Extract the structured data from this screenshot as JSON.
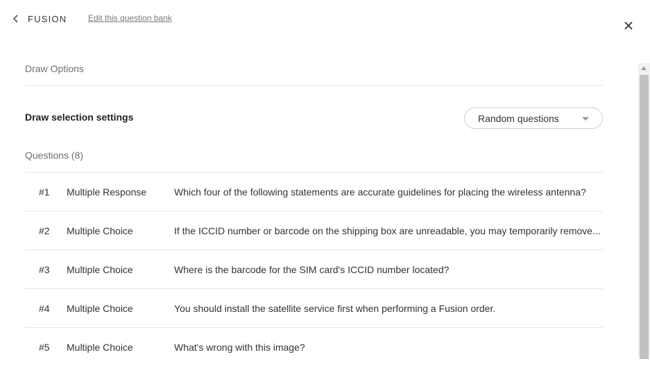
{
  "header": {
    "back_label": "FUSION",
    "edit_link": "Edit this question bank"
  },
  "draw_options": {
    "title": "Draw Options",
    "settings_label": "Draw selection settings",
    "selection": "Random questions"
  },
  "questions": {
    "title": "Questions (8)",
    "rows": [
      {
        "num": "#1",
        "type": "Multiple Response",
        "text": "Which four of the following statements are accurate guidelines for placing the wireless antenna?"
      },
      {
        "num": "#2",
        "type": "Multiple Choice",
        "text": "If the ICCID number or barcode on the shipping box are unreadable, you may temporarily remove..."
      },
      {
        "num": "#3",
        "type": "Multiple Choice",
        "text": "Where is the barcode for the SIM card's ICCID number located?"
      },
      {
        "num": "#4",
        "type": "Multiple Choice",
        "text": "You should install the satellite service first when performing a Fusion order."
      },
      {
        "num": "#5",
        "type": "Multiple Choice",
        "text": "What's wrong with this image?"
      }
    ]
  }
}
